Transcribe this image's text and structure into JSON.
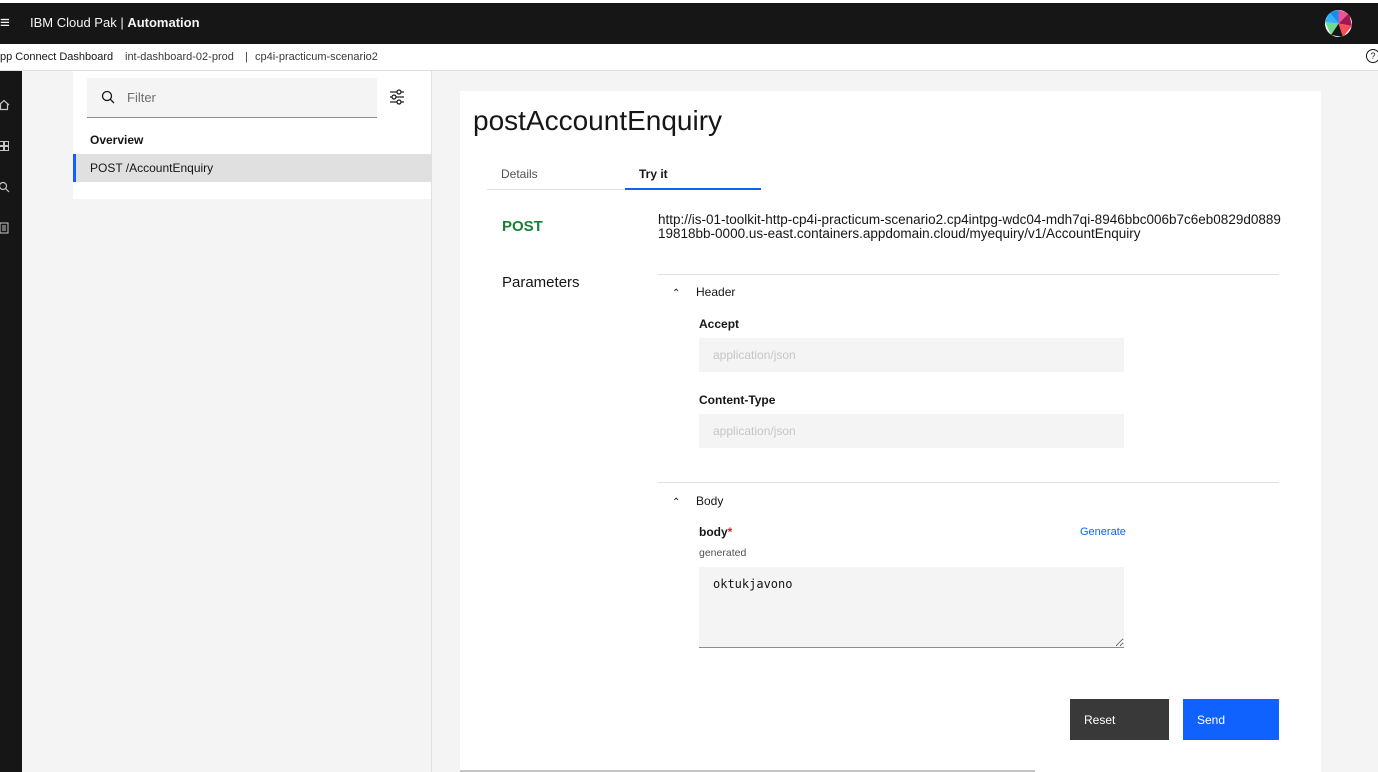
{
  "header": {
    "hamburger_glyph": "≡",
    "brand_prefix": "IBM Cloud Pak | ",
    "brand_bold": "Automation",
    "kebab_glyph": "⋮"
  },
  "breadcrumb": {
    "app": "pp Connect Dashboard",
    "instance": "int-dashboard-02-prod",
    "separator": "|",
    "project": "cp4i-practicum-scenario2",
    "help_glyph": "?"
  },
  "sidebar": {
    "search_placeholder": "Filter",
    "overview_label": "Overview",
    "items": [
      {
        "label": "POST /AccountEnquiry",
        "selected": true
      }
    ]
  },
  "main": {
    "title": "postAccountEnquiry",
    "tabs": [
      {
        "label": "Details",
        "active": false
      },
      {
        "label": "Try it",
        "active": true
      }
    ],
    "method": "POST",
    "url": "http://is-01-toolkit-http-cp4i-practicum-scenario2.cp4intpg-wdc04-mdh7qi-8946bbc006b7c6eb0829d088919818bb-0000.us-east.containers.appdomain.cloud/myequiry/v1/AccountEnquiry",
    "parameters_label": "Parameters",
    "header_section": {
      "label": "Header",
      "fields": [
        {
          "label": "Accept",
          "placeholder": "application/json"
        },
        {
          "label": "Content-Type",
          "placeholder": "application/json"
        }
      ]
    },
    "body_section": {
      "label": "Body",
      "field_label": "body",
      "required_mark": "*",
      "generate_label": "Generate",
      "helper": "generated",
      "value": "oktukjavono"
    },
    "reset_label": "Reset",
    "send_label": "Send"
  },
  "colors": {
    "accent": "#0f62fe",
    "method_post": "#198038",
    "topbar": "#161616",
    "reset_button": "#393939"
  }
}
